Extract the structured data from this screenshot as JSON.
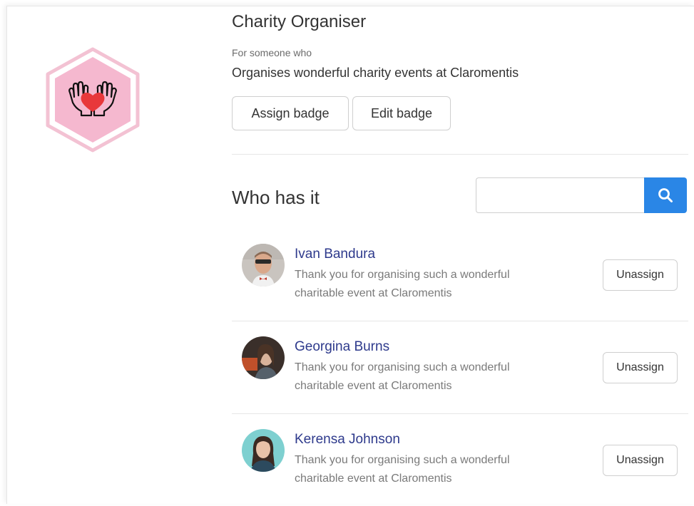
{
  "badge": {
    "title": "Charity Organiser",
    "for_label": "For someone who",
    "description": "Organises wonderful charity events at Claromentis",
    "icon": "hands-heart-icon",
    "hex_color": "#f5b8cf",
    "hex_border_color": "#f3c2d3",
    "heart_color": "#e8383b"
  },
  "actions": {
    "assign_label": "Assign badge",
    "edit_label": "Edit badge"
  },
  "holders": {
    "title": "Who has it",
    "search": {
      "value": "",
      "placeholder": "",
      "icon": "search-icon",
      "button_color": "#2a86e6"
    },
    "people": [
      {
        "name": "Ivan Bandura",
        "note": "Thank you for organising such a wonderful charitable event at Claromentis",
        "action_label": "Unassign"
      },
      {
        "name": "Georgina Burns",
        "note": "Thank you for organising such a wonderful charitable event at Claromentis",
        "action_label": "Unassign"
      },
      {
        "name": "Kerensa Johnson",
        "note": "Thank you for organising such a wonderful charitable event at Claromentis",
        "action_label": "Unassign"
      }
    ]
  }
}
